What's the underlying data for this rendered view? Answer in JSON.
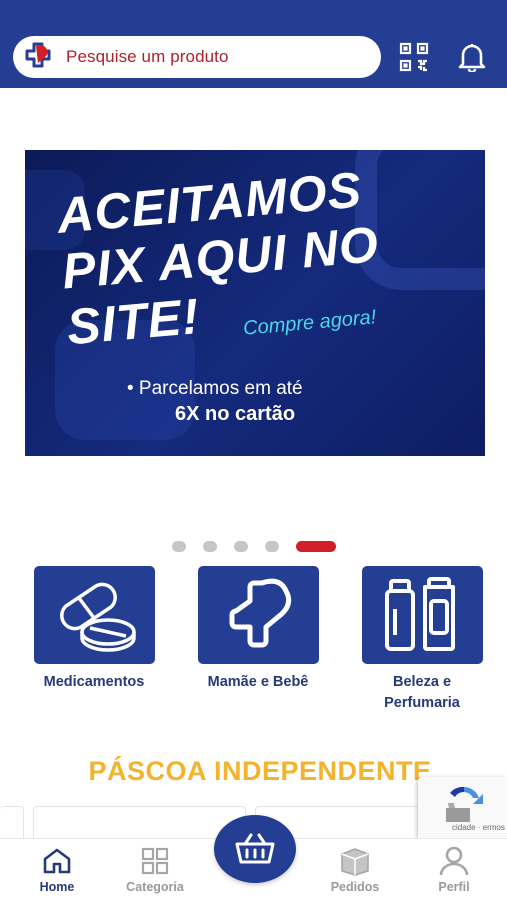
{
  "header": {
    "search_placeholder": "Pesquise um produto",
    "icons": [
      "app-logo-icon",
      "qr-code-icon",
      "bell-icon"
    ]
  },
  "banner": {
    "headline": [
      "ACEITAMOS",
      "PIX AQUI NO",
      "SITE!"
    ],
    "cta": "Compre agora!",
    "subline1": "• Parcelamos em até",
    "subline2": "6X no cartão"
  },
  "carousel": {
    "total": 5,
    "active_index": 4
  },
  "categories": [
    {
      "label": "Medicamentos",
      "icon": "pills-icon"
    },
    {
      "label": "Mamãe e Bebê",
      "icon": "heart-cross-icon"
    },
    {
      "label": "Beleza e Perfumaria",
      "icon": "bottles-icon"
    }
  ],
  "section": {
    "title": "PÁSCOA INDEPENDENTE"
  },
  "recaptcha": {
    "text": "cidade · ermos"
  },
  "bottom_nav": {
    "items": [
      {
        "label": "Home",
        "icon": "home-icon",
        "active": true
      },
      {
        "label": "Categoria",
        "icon": "grid-icon",
        "active": false
      },
      {
        "label": "Pedidos",
        "icon": "box-icon",
        "active": false
      },
      {
        "label": "Perfil",
        "icon": "user-icon",
        "active": false
      }
    ],
    "center_button_icon": "basket-icon"
  },
  "colors": {
    "primary": "#243e93",
    "accent": "#d2202a",
    "section_title": "#f3b32c",
    "cta": "#4ed6e8"
  }
}
